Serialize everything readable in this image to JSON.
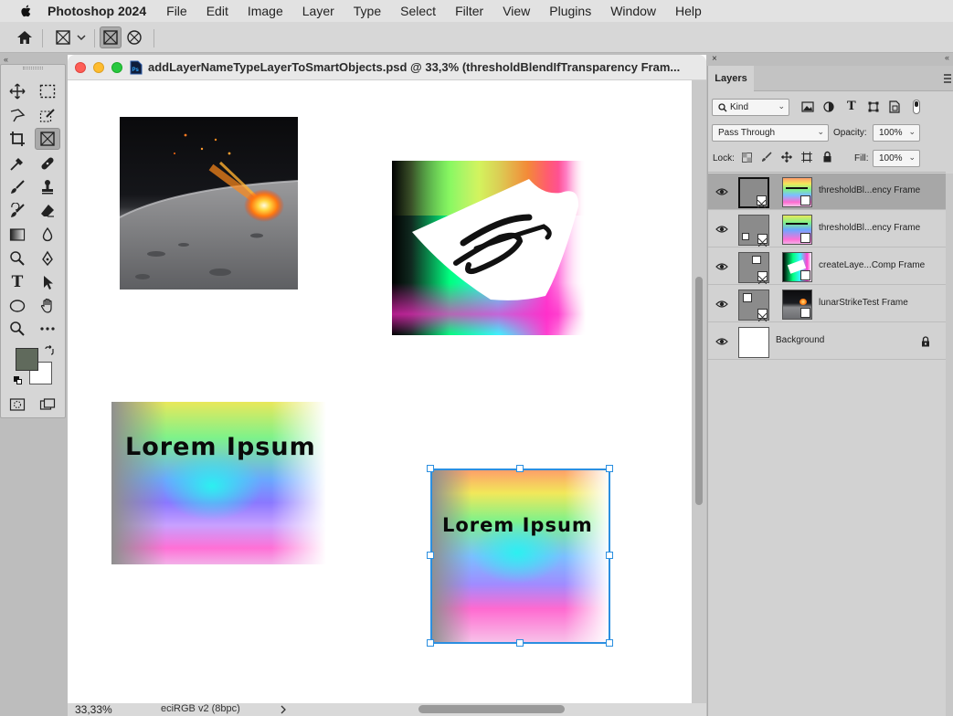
{
  "menubar": {
    "app_name": "Photoshop 2024",
    "items": [
      "File",
      "Edit",
      "Image",
      "Layer",
      "Type",
      "Select",
      "Filter",
      "View",
      "Plugins",
      "Window",
      "Help"
    ]
  },
  "options_bar": {
    "icons": [
      "home-icon",
      "frame-tool-icon",
      "rectangle-frame-icon",
      "ellipse-frame-icon"
    ]
  },
  "tools": {
    "foreground_color": "#606a5c",
    "background_color": "#ffffff",
    "type_tool_label": "T"
  },
  "document": {
    "title": "addLayerNameTypeLayerToSmartObjects.psd @ 33,3% (thresholdBlendIfTransparency Fram...",
    "zoom": "33,33%",
    "color_profile": "eciRGB v2 (8bpc)",
    "lorem_text_1": "Lorem Ipsum",
    "lorem_text_2": "Lorem Ipsum"
  },
  "layers_panel": {
    "tab_label": "Layers",
    "filter_kind": "Kind",
    "blend_mode": "Pass Through",
    "opacity_label": "Opacity:",
    "opacity_value": "100%",
    "lock_label": "Lock:",
    "fill_label": "Fill:",
    "fill_value": "100%",
    "layers": [
      {
        "name": "thresholdBl...ency Frame",
        "selected": true
      },
      {
        "name": "thresholdBl...ency Frame",
        "selected": false
      },
      {
        "name": "createLaye...Comp Frame",
        "selected": false
      },
      {
        "name": "lunarStrikeTest Frame",
        "selected": false
      },
      {
        "name": "Background",
        "selected": false
      }
    ]
  },
  "colors": {
    "selection_accent": "#2b8fe0",
    "panel_bg": "#d2d2d2"
  }
}
